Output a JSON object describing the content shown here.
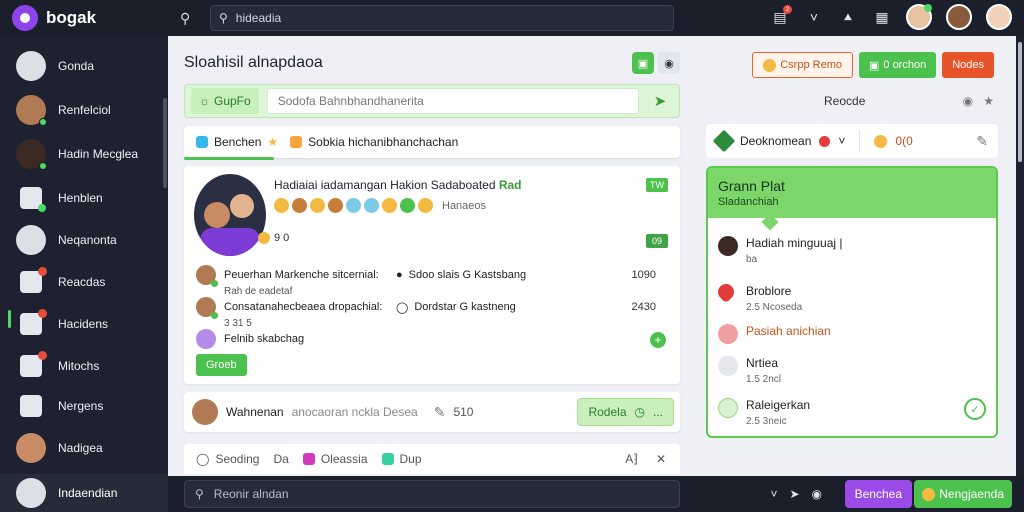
{
  "app": {
    "name": "bogak"
  },
  "topbar": {
    "search_placeholder": "hideadia",
    "badge_count": "2"
  },
  "sidebar": {
    "items": [
      {
        "label": "Gonda",
        "icon": "person-icon"
      },
      {
        "label": "Renfelciol",
        "icon": "avatar-photo"
      },
      {
        "label": "Hadin Mecglea",
        "icon": "avatar-photo"
      },
      {
        "label": "Henblen",
        "icon": "monitor-icon"
      },
      {
        "label": "Neqanonta",
        "icon": "chat-icon"
      },
      {
        "label": "Reacdas",
        "icon": "grid-icon"
      },
      {
        "label": "Hacidens",
        "icon": "inbox-icon"
      },
      {
        "label": "Mitochs",
        "icon": "bell-icon"
      },
      {
        "label": "Nergens",
        "icon": "edit-icon"
      },
      {
        "label": "Nadigea",
        "icon": "avatar-photo"
      }
    ],
    "bottom_user": "Indaendian"
  },
  "main": {
    "title": "Sloahisil alnapdaoa",
    "composer": {
      "tag": "GupFo",
      "placeholder": "Sodofa Bahnbhandhanerita"
    },
    "tabs": [
      {
        "label": "Benchen"
      },
      {
        "label": "Sobkia hichanibhanchachan"
      }
    ],
    "feed": {
      "title_main": "Hadiaiai iadamangan Hakion Sadaboated",
      "title_highlight": "Rad",
      "badge": "TW",
      "reaction_count": "Hanaeos",
      "sub_text": "9 0",
      "badge2": "09",
      "rows": [
        {
          "left": "Peuerhan Markenche sitcernial:",
          "mid": "Sdoo slais G Kastsbang",
          "num": "1090",
          "sub": "Rah de eadetaf"
        },
        {
          "left": "Consatanahecbeaea dropachial:",
          "mid": "Dordstar G kastneng",
          "num": "2430",
          "sub": "3 31 5"
        },
        {
          "left": "Felnib skabchag",
          "mid": "",
          "num": "",
          "sub": ""
        }
      ],
      "group_button": "Groeb"
    },
    "poster": {
      "name": "Wahnenan",
      "hint": "anocaoran nckla Desea",
      "count": "510",
      "button": "Rodela"
    },
    "toolbar": {
      "item1": "Seoding",
      "item2": "Da",
      "item3": "Oleassia",
      "item4": "Dup"
    }
  },
  "right": {
    "buttons": [
      {
        "label": "Csrpp Remo"
      },
      {
        "label": "0 orchon"
      },
      {
        "label": "Nodes"
      }
    ],
    "subtitle": "Reocde",
    "card1": {
      "label": "Deoknomean",
      "count": "0(0"
    },
    "group": {
      "title": "Grann Plat",
      "subtitle": "Sladanchiah",
      "items": [
        {
          "title": "Hadiah minguuaj |",
          "sub": "ba"
        },
        {
          "title": "Broblore",
          "sub": "2.5 Ncoseda"
        },
        {
          "title": "Pasiah anichian",
          "sub": ""
        },
        {
          "title": "Nrtiea",
          "sub": "1.5 2ncl"
        },
        {
          "title": "Raleigerkan",
          "sub": "2.5 3neic"
        }
      ]
    }
  },
  "bottombar": {
    "placeholder": "Reonir alndan",
    "button_purple": "Benchea",
    "button_green": "Nengjaenda"
  }
}
